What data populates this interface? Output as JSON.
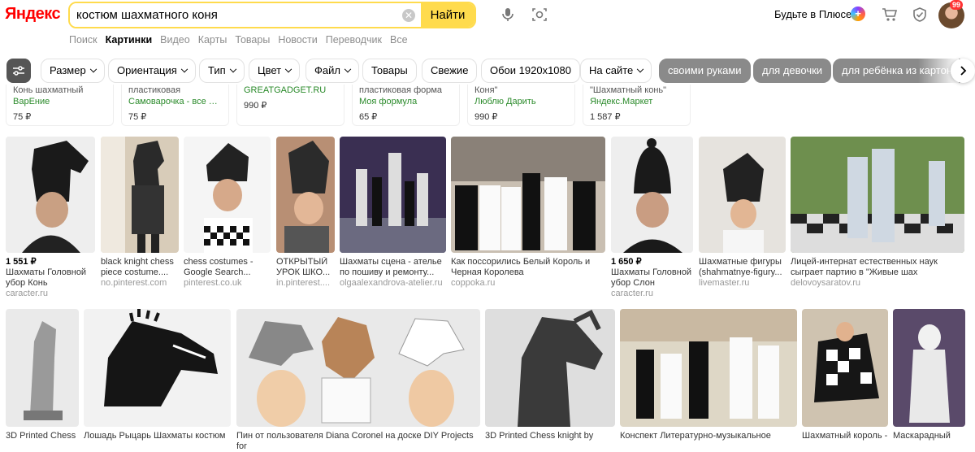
{
  "header": {
    "logo": "Яндекс",
    "search_value": "костюм шахматного коня",
    "find_label": "Найти",
    "plus_label": "Будьте в Плюсе",
    "avatar_badge": "99"
  },
  "service_tabs": [
    "Поиск",
    "Картинки",
    "Видео",
    "Карты",
    "Товары",
    "Новости",
    "Переводчик",
    "Все"
  ],
  "filters": {
    "chips": [
      "Размер",
      "Ориентация",
      "Тип",
      "Цвет",
      "Файл",
      "Товары",
      "Свежие",
      "Обои 1920x1080",
      "На сайте"
    ],
    "dark_chips": [
      "своими руками",
      "для девочки",
      "для ребёнка из картона"
    ]
  },
  "products": [
    {
      "title": "Конь шахматный",
      "shop": "ВарЕние",
      "price": "75 ₽"
    },
    {
      "title": "пластиковая",
      "shop": "Самоварочка - все для...",
      "price": "75 ₽"
    },
    {
      "title": "GREATGADGET.RU",
      "shop": "",
      "price": "990 ₽"
    },
    {
      "title": "пластиковая форма",
      "shop": "Моя формула",
      "price": "65 ₽"
    },
    {
      "title": "Коня\"",
      "shop": "Люблю Дарить",
      "price": "990 ₽"
    },
    {
      "title": "\"Шахматный конь\"",
      "shop": "Яндекс.Маркет",
      "price": "1 587 ₽"
    }
  ],
  "row1": [
    {
      "price": "1 551 ₽",
      "title": "Шахматы Головной убор Конь",
      "host": "caracter.ru"
    },
    {
      "price": "",
      "title": "black knight chess piece costume....",
      "host": "no.pinterest.com"
    },
    {
      "price": "",
      "title": "chess costumes - Google Search...",
      "host": "pinterest.co.uk"
    },
    {
      "price": "",
      "title": "ОТКРЫТЫЙ УРОК ШКО...",
      "host": "in.pinterest...."
    },
    {
      "price": "",
      "title": "Шахматы сцена - ателье по пошиву и ремонту...",
      "host": "olgaalexandrova-atelier.ru"
    },
    {
      "price": "",
      "title": "Как поссорились Белый Король и Черная Королева",
      "host": "coppoka.ru"
    },
    {
      "price": "1 650 ₽",
      "title": "Шахматы Головной убор Слон",
      "host": "caracter.ru"
    },
    {
      "price": "",
      "title": "Шахматные фигуры (shahmatnye-figury...",
      "host": "livemaster.ru"
    },
    {
      "price": "",
      "title": "Лицей-интернат естественных наук сыграет партию в \"Живые шах",
      "host": "delovoysaratov.ru"
    }
  ],
  "row2": [
    {
      "title": "3D Printed Chess"
    },
    {
      "title": "Лошадь Рыцарь Шахматы костюм"
    },
    {
      "title": "Пин от пользователя Diana Coronel на доске DIY Projects for"
    },
    {
      "title": "3D Printed Chess knight by"
    },
    {
      "title": "Конспект Литературно-музыкальное"
    },
    {
      "title": "Шахматный король -"
    },
    {
      "title": "Маскарадный"
    }
  ],
  "colors": {
    "accent": "#ffdb4d",
    "logo_red": "#ff0000",
    "dark_chip": "#8a8a8a"
  }
}
